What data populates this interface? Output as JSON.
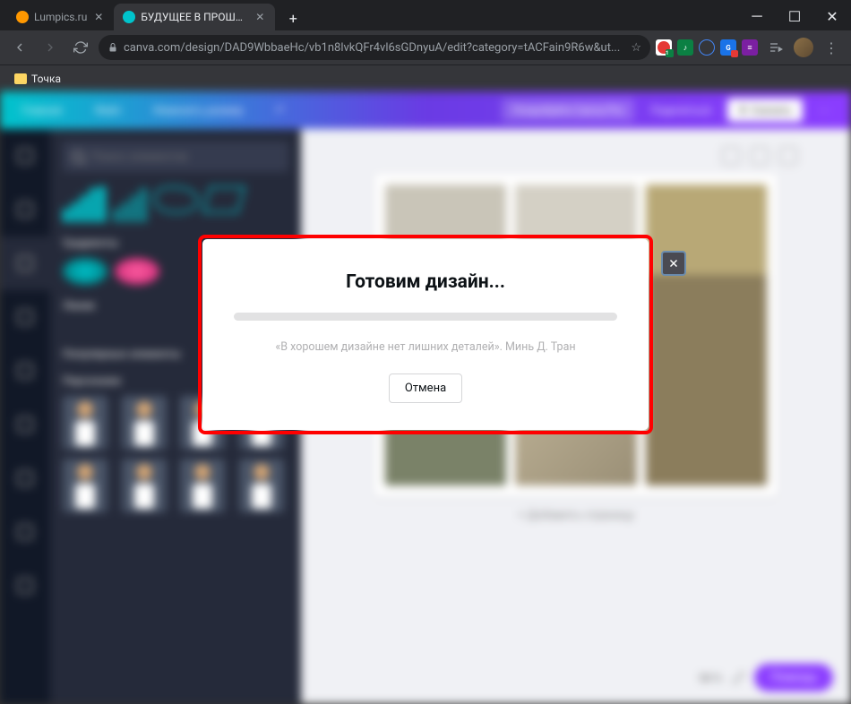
{
  "browser": {
    "tabs": [
      {
        "title": "Lumpics.ru",
        "favicon_color": "#ff9800"
      },
      {
        "title": "БУДУЩЕЕ В ПРОШЛОМ — Фото",
        "favicon_color": "#00c4cc"
      }
    ],
    "url": "canva.com/design/DAD9WbbaeHc/vb1n8lvkQFr4vl6sGDnyuA/edit?category=tACFain9R6w&ut...",
    "bookmarks": [
      {
        "label": "Точка"
      }
    ]
  },
  "app": {
    "header": {
      "home": "Главная",
      "file": "Файл",
      "resize": "Изменить размер",
      "try_pro": "Попробуйте Canva Pro",
      "share": "Поделиться",
      "download": "Скачать"
    },
    "sidebar": {
      "search_placeholder": "Поиск элементов",
      "sections": {
        "gradients": "Градиенты",
        "lines": "Линии",
        "popular": "Популярные элементы",
        "characters": "Персонажи"
      }
    },
    "canvas": {
      "add_page": "+ Добавить страницу"
    },
    "footer": {
      "zoom": "54 %",
      "help": "Помощь"
    }
  },
  "modal": {
    "title": "Готовим дизайн...",
    "quote": "«В хорошем дизайне нет лишних деталей». Минь Д. Тран",
    "cancel": "Отмена"
  }
}
